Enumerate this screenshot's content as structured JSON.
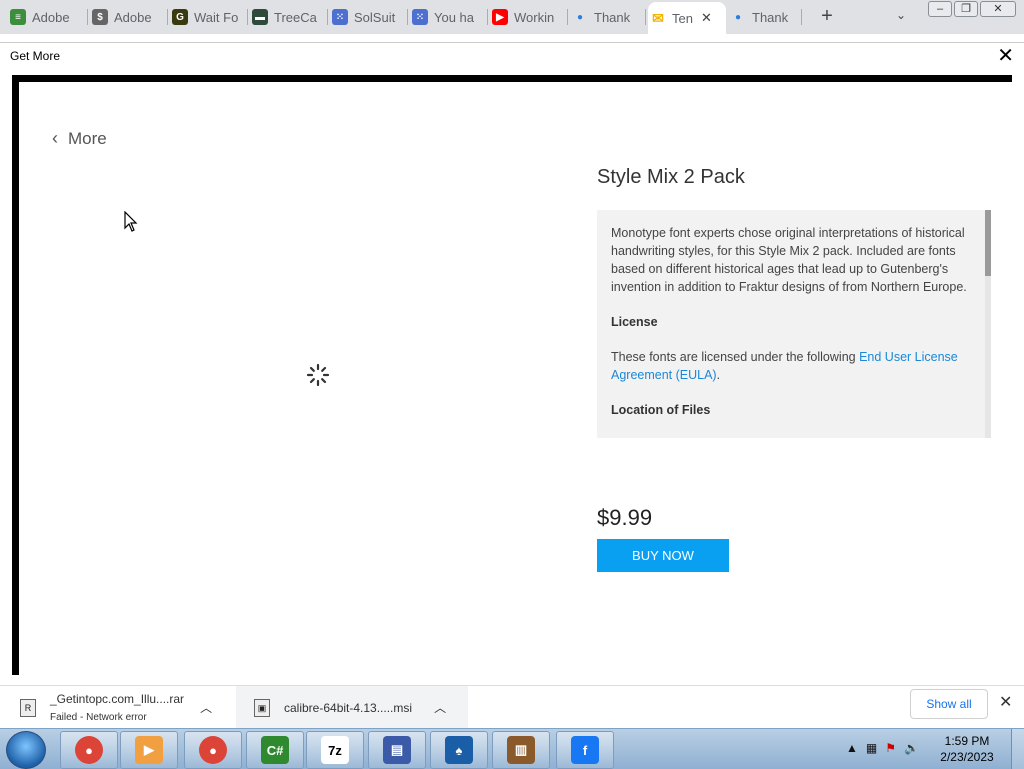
{
  "browser": {
    "tabs": [
      {
        "label": "Adobe",
        "icon": "adobe-stock-icon",
        "color": "#3c8d3c",
        "glyph": "≡"
      },
      {
        "label": "Adobe",
        "icon": "dollar-circle-icon",
        "color": "#666666",
        "glyph": "$"
      },
      {
        "label": "Wait Fo",
        "icon": "g-logo-icon",
        "color": "#3a3a10",
        "glyph": "G"
      },
      {
        "label": "TreeCa",
        "icon": "treecard-icon",
        "color": "#2e4a3a",
        "glyph": "▬"
      },
      {
        "label": "SolSuit",
        "icon": "dots-icon",
        "color": "#4d6fcf",
        "glyph": "⁙"
      },
      {
        "label": "You ha",
        "icon": "dots-icon",
        "color": "#4d6fcf",
        "glyph": "⁙"
      },
      {
        "label": "Workin",
        "icon": "youtube-icon",
        "color": "#ff0000",
        "glyph": "▶"
      },
      {
        "label": "Thank",
        "icon": "balloon-icon",
        "color": "#2a7de1",
        "glyph": "●"
      },
      {
        "label": "Ten",
        "icon": "envelope-icon",
        "color": "#f5b400",
        "glyph": "✉",
        "active": true
      },
      {
        "label": "Thank",
        "icon": "balloon-icon",
        "color": "#2a7de1",
        "glyph": "●"
      }
    ],
    "new_tab": "+",
    "tab_menu": "⌄",
    "window_buttons": [
      "–",
      "❐",
      "✕"
    ]
  },
  "dialog": {
    "title": "Get More",
    "close": "✕"
  },
  "content": {
    "back_label": "More",
    "product_title": "Style Mix 2 Pack",
    "description": "Monotype font experts chose original interpretations of historical handwriting styles, for this Style Mix 2 pack. Included are fonts based on different historical ages that lead up to Gutenberg's invention in addition to Fraktur designs of from Northern Europe.",
    "license_heading": "License",
    "license_text": "These fonts are licensed under the following",
    "license_link": "End User License Agreement (EULA)",
    "license_end": ".",
    "location_heading": "Location of Files",
    "price": "$9.99",
    "buy_label": "BUY NOW",
    "accent_color": "#0aa0f2"
  },
  "downloads": {
    "items": [
      {
        "name": "_Getintopc.com_Illu....rar",
        "status": "Failed - Network error",
        "icon": "rar-icon"
      },
      {
        "name": "calibre-64bit-4.13.....msi",
        "status": "",
        "icon": "msi-icon"
      }
    ],
    "show_all": "Show all",
    "close": "✕"
  },
  "taskbar": {
    "apps": [
      {
        "name": "chrome-icon",
        "glyph": "●"
      },
      {
        "name": "media-player-icon",
        "glyph": "▶"
      },
      {
        "name": "chrome-icon",
        "glyph": "●"
      },
      {
        "name": "csharp-icon",
        "glyph": "C#"
      },
      {
        "name": "7zip-icon",
        "glyph": "7z"
      },
      {
        "name": "installer-icon",
        "glyph": "▤"
      },
      {
        "name": "solitaire-icon",
        "glyph": "♠"
      },
      {
        "name": "books-icon",
        "glyph": "▥"
      },
      {
        "name": "facebook-icon",
        "glyph": "f"
      }
    ],
    "time": "1:59 PM",
    "date": "2/23/2023"
  }
}
